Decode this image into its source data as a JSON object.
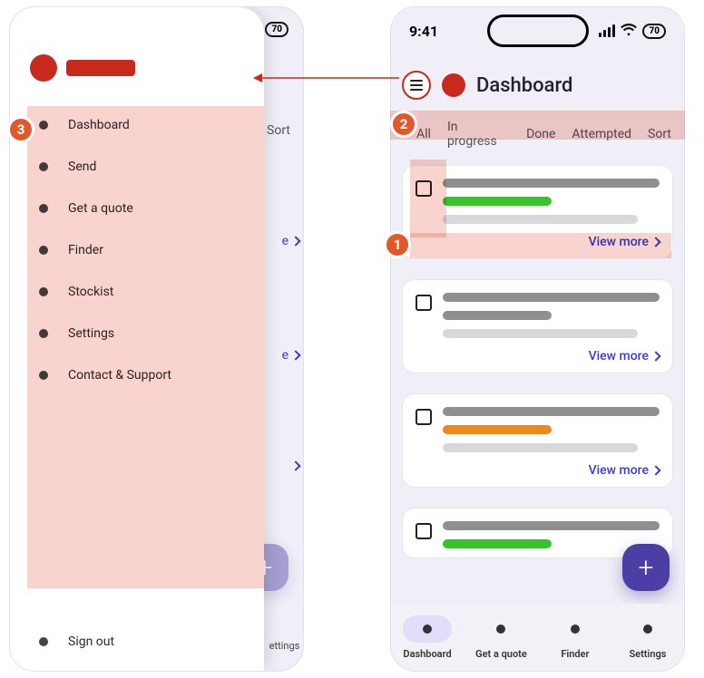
{
  "status": {
    "time": "9:41",
    "battery": "70"
  },
  "header": {
    "title": "Dashboard"
  },
  "filters": {
    "all": "All",
    "inprogress": "In progress",
    "done": "Done",
    "attempted": "Attempted",
    "sort": "Sort"
  },
  "cards": {
    "view_more": "View more"
  },
  "fab": {
    "label": "+"
  },
  "tabs": {
    "dashboard": "Dashboard",
    "quote": "Get a quote",
    "finder": "Finder",
    "settings": "Settings"
  },
  "drawer": {
    "items": {
      "dashboard": "Dashboard",
      "send": "Send",
      "quote": "Get a quote",
      "finder": "Finder",
      "stockist": "Stockist",
      "settings": "Settings",
      "support": "Contact & Support",
      "signout": "Sign out"
    }
  },
  "left_under": {
    "sort": "Sort",
    "tab_hint": "ettings"
  },
  "icons": {
    "hamburger": "hamburger-icon",
    "chevron": "chevron-right-icon",
    "wifi": "wifi-icon",
    "signal": "signal-icon",
    "plus": "plus-icon"
  }
}
